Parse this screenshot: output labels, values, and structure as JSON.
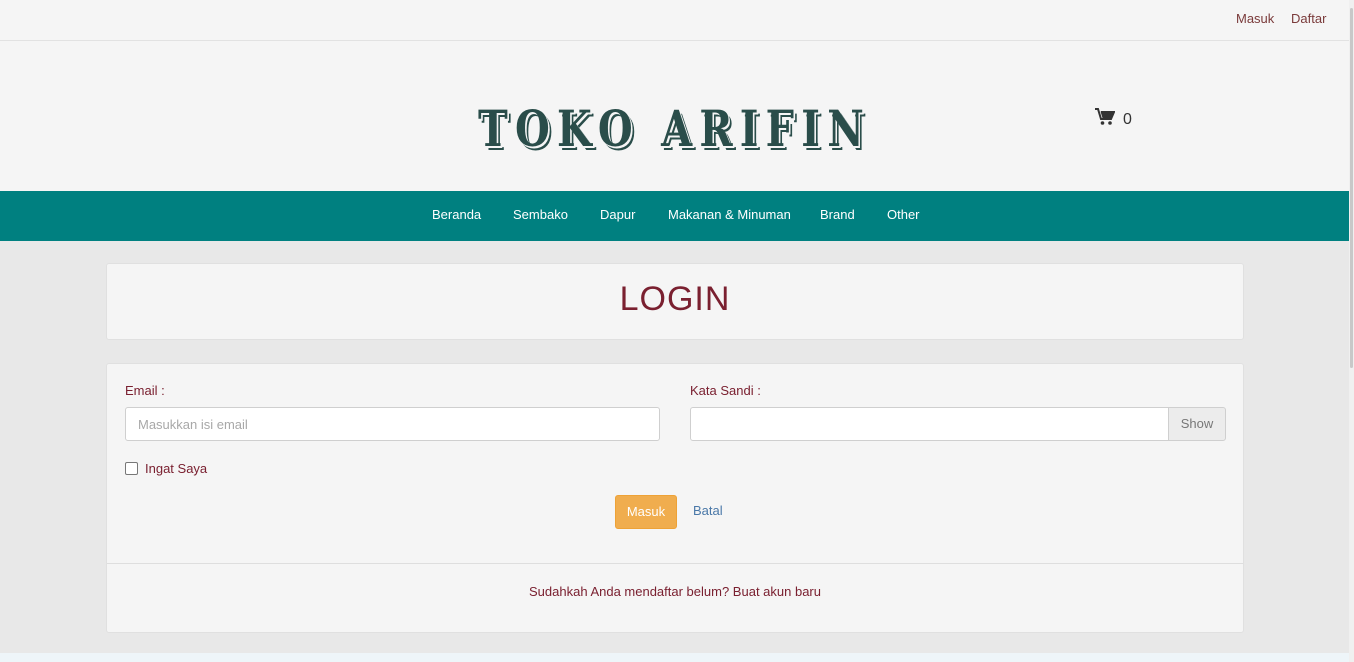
{
  "topbar": {
    "login_link": "Masuk",
    "register_link": "Daftar"
  },
  "header": {
    "brand": "TOKO ARIFIN",
    "cart_icon": "shopping-cart-icon",
    "cart_count": "0"
  },
  "nav": {
    "items": [
      "Beranda",
      "Sembako",
      "Dapur",
      "Makanan & Minuman",
      "Brand",
      "Other"
    ]
  },
  "login": {
    "title": "LOGIN",
    "email_label": "Email :",
    "email_placeholder": "Masukkan isi email",
    "password_label": "Kata Sandi :",
    "password_value": "",
    "show_button": "Show",
    "remember_label": "Ingat Saya",
    "remember_checked": false,
    "submit_button": "Masuk",
    "cancel_link": "Batal",
    "footer_text": "Sudahkah Anda mendaftar belum? Buat akun baru"
  },
  "colors": {
    "nav_bg": "#008080",
    "brand_text": "#2a4d4a",
    "accent_text": "#7a2030",
    "submit_bg": "#f0ad4e"
  }
}
